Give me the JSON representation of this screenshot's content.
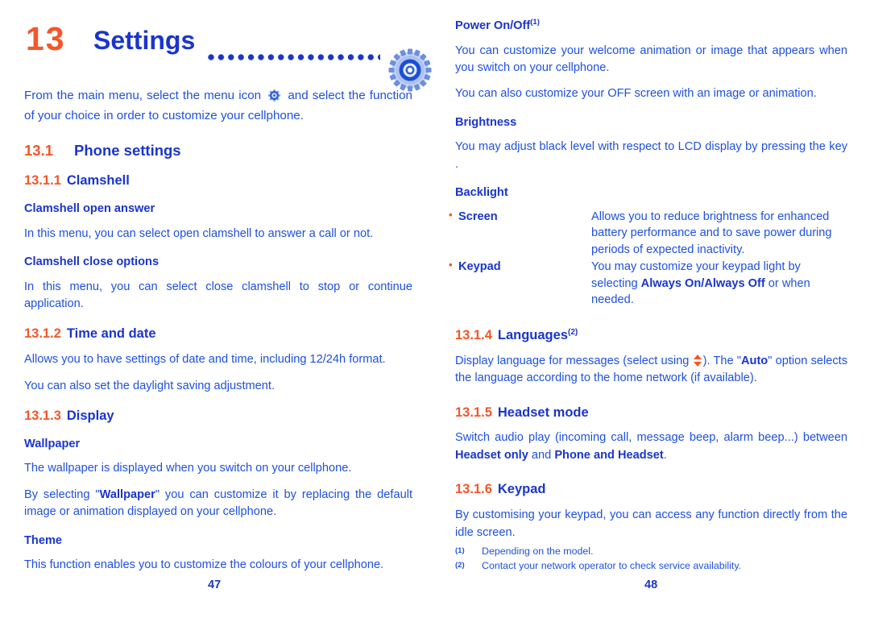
{
  "document": {
    "chapter_number": "13",
    "chapter_title": "Settings",
    "icon": "gear-icon"
  },
  "left_page": {
    "page_number": "47",
    "intro": {
      "before_icon": "From the main menu, select the menu icon",
      "after_icon": "and select the function of your choice in order to customize your cellphone."
    },
    "sections": [
      {
        "number": "13.1",
        "title": "Phone settings"
      },
      {
        "number": "13.1.1",
        "title": "Clamshell"
      }
    ],
    "clamshell_open_answer": {
      "heading": "Clamshell open answer",
      "body": "In this menu, you can select open clamshell to answer a call or not."
    },
    "clamshell_close_options": {
      "heading": "Clamshell close options",
      "body": "In this menu, you can select close clamshell to stop or continue application."
    },
    "time_and_date": {
      "number": "13.1.2",
      "title": "Time and date",
      "body1": "Allows you to have settings of date and time, including 12/24h format.",
      "body2": "You can also set the daylight saving adjustment."
    },
    "display": {
      "number": "13.1.3",
      "title": "Display"
    },
    "wallpaper": {
      "heading": "Wallpaper",
      "body1": "The wallpaper is displayed when you switch on your cellphone.",
      "body2_part1": "By selecting \"",
      "body2_bold": "Wallpaper",
      "body2_part2": "\" you can customize it by replacing the default image or animation displayed on your cellphone."
    },
    "theme": {
      "heading": "Theme",
      "body": "This function enables you to customize the colours of your cellphone."
    }
  },
  "right_page": {
    "page_number": "48",
    "power_on_off": {
      "heading": "Power On/Off",
      "footnote_mark": "(1)",
      "body1": "You can customize your welcome animation or image that appears when you switch on your cellphone.",
      "body2": "You can also customize your OFF screen with an image or animation."
    },
    "brightness": {
      "heading": "Brightness",
      "body": "You may adjust black level with respect to LCD display by pressing the key ."
    },
    "backlight": {
      "heading": "Backlight",
      "items": [
        {
          "term": "Screen",
          "description": "Allows you to reduce brightness for enhanced battery performance and to save power during periods of expected inactivity."
        },
        {
          "term": "Keypad",
          "desc_part1": "You may customize your keypad light by selecting ",
          "desc_bold": "Always On/Always Off",
          "desc_part2": " or when needed."
        }
      ]
    },
    "languages": {
      "number": "13.1.4",
      "title": "Languages",
      "footnote_mark": "(2)",
      "body_part1": "Display language for messages (select using ",
      "body_part2": "). The \"",
      "body_bold": "Auto",
      "body_part3": "\" option selects the language according to the home network (if available)."
    },
    "headset_mode": {
      "number": "13.1.5",
      "title": "Headset mode",
      "body_part1": "Switch audio play (incoming call, message beep, alarm beep...) between ",
      "body_bold1": "Headset only",
      "body_part2": " and ",
      "body_bold2": "Phone and Headset",
      "body_part3": "."
    },
    "keypad": {
      "number": "13.1.6",
      "title": "Keypad",
      "body": "By customising your keypad, you can access any function directly from the idle screen."
    },
    "footnotes": [
      {
        "mark": "(1)",
        "text": "Depending on the model."
      },
      {
        "mark": "(2)",
        "text": "Contact your network operator to check service availability."
      }
    ]
  },
  "colors": {
    "orange": "#F4562A",
    "heading_blue": "#1A35CC",
    "body_blue": "#1E50E0"
  }
}
